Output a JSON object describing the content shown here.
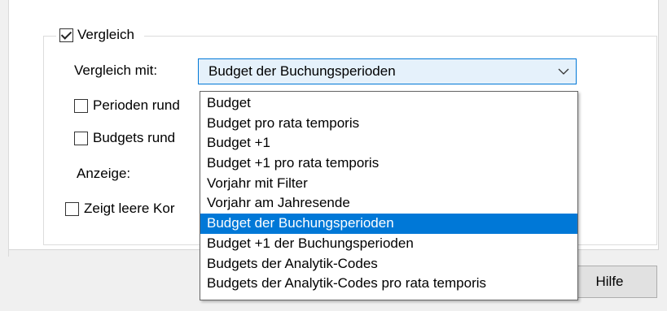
{
  "comparison": {
    "checkbox_label": "Vergleich",
    "checked": true,
    "compare_with_label": "Vergleich mit:",
    "selected_value": "Budget der Buchungsperioden",
    "round_periods_label": "Perioden rund",
    "round_budgets_label": "Budgets rund",
    "display_label": "Anzeige:",
    "show_empty_label": "Zeigt leere Kor",
    "chevron_icon": "chevron-down-icon"
  },
  "dropdown": {
    "items": [
      "Budget",
      "Budget pro rata temporis",
      "Budget +1",
      "Budget +1 pro rata temporis",
      "Vorjahr mit Filter",
      "Vorjahr am Jahresende",
      "Budget der Buchungsperioden",
      "Budget +1 der Buchungsperioden",
      "Budgets der Analytik-Codes",
      "Budgets der Analytik-Codes pro rata temporis"
    ],
    "selected_index": 6
  },
  "footer": {
    "help_label": "Hilfe"
  },
  "colors": {
    "accent": "#0078d7",
    "combo_bg": "#e5f1fb"
  }
}
